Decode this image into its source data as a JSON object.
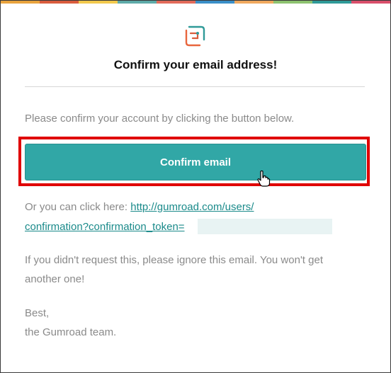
{
  "colors": {
    "accent": "#31a7a6",
    "link": "#1a8a8a",
    "highlight_border": "#e00000",
    "topbar": [
      "#e8a33d",
      "#d95c3d",
      "#f2c94c",
      "#5eaaa8",
      "#e26b5a",
      "#3a8fc8",
      "#f0a85e",
      "#8dc26f",
      "#2f9a98",
      "#d94f6b"
    ]
  },
  "email": {
    "logo_icon": "gumroad-logo-icon",
    "title": "Confirm your email address!",
    "intro": "Please confirm your account by clicking the button below.",
    "button_label": "Confirm email",
    "alt_prefix": "Or you can click here: ",
    "alt_link_line1": "http://gumroad.com/users/",
    "alt_link_line2": "confirmation?confirmation_token=",
    "ignore_line1": "If you didn't request this, please ignore this email. You won't get",
    "ignore_line2": "another one!",
    "signoff_line1": "Best,",
    "signoff_line2": "the Gumroad team."
  }
}
